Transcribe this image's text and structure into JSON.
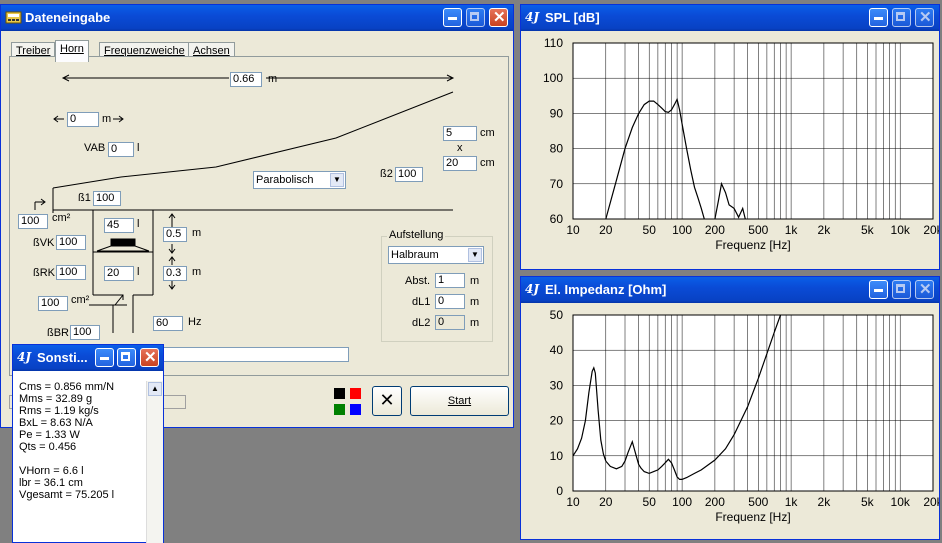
{
  "dateneingabe": {
    "title": "Dateneingabe",
    "tabs": [
      {
        "label": "Treiber"
      },
      {
        "label": "Horn"
      },
      {
        "label": "Frequenzweiche"
      },
      {
        "label": "Achsen"
      }
    ],
    "horn": {
      "length_value": "0.66",
      "length_unit": "m",
      "offset_value": "0",
      "offset_unit": "m",
      "vab_label": "VAB",
      "vab_value": "0",
      "vab_unit": "l",
      "mouth_w_value": "5",
      "mouth_w_unit": "cm",
      "times": "x",
      "mouth_h_value": "20",
      "mouth_h_unit": "cm",
      "profile_selected": "Parabolisch",
      "beta1_label": "ß1",
      "beta1_value": "100",
      "beta2_label": "ß2",
      "beta2_value": "100",
      "throat_value": "100",
      "throat_unit": "cm²",
      "bvk_label": "ßVK",
      "bvk_value": "100",
      "vk_value": "45",
      "vk_unit": "l",
      "rk_value": "20",
      "rk_unit": "l",
      "brk_label": "ßRK",
      "brk_value": "100",
      "d1_value": "0.5",
      "d1_unit": "m",
      "d2_value": "0.3",
      "d2_unit": "m",
      "port_value": "100",
      "port_unit": "cm²",
      "bbr_label": "ßBR",
      "bbr_value": "100",
      "freq_value": "60",
      "freq_unit": "Hz",
      "aufstellung": {
        "label": "Aufstellung",
        "selected": "Halbraum",
        "abst_label": "Abst.",
        "abst_value": "1",
        "abst_unit": "m",
        "dl1_label": "dL1",
        "dl1_value": "0",
        "dl1_unit": "m",
        "dl2_label": "dL2",
        "dl2_value": "0",
        "dl2_unit": "m"
      }
    },
    "start_label": "Start",
    "colors": {
      "black": "#000000",
      "red": "#ff0000",
      "green": "#008000",
      "blue": "#0000ff"
    }
  },
  "sonstiges": {
    "title": "Sonsti...",
    "lines": [
      "Cms = 0.856 mm/N",
      "Mms = 32.89 g",
      "Rms = 1.19 kg/s",
      "BxL = 8.63 N/A",
      "Pe = 1.33 W",
      "Qts = 0.456",
      "",
      "VHorn = 6.6 l",
      "lbr = 36.1 cm",
      "Vgesamt = 75.205 l"
    ]
  },
  "spl_window": {
    "title": "SPL [dB]"
  },
  "impedance_window": {
    "title": "El. Impedanz [Ohm]"
  },
  "chart_data": [
    {
      "type": "line",
      "title": "SPL [dB]",
      "xlabel": "Frequenz [Hz]",
      "ylabel": "",
      "x_scale": "log",
      "xlim": [
        10,
        20000
      ],
      "ylim": [
        60,
        110
      ],
      "x_ticks": [
        "10",
        "20",
        "50",
        "100",
        "200",
        "500",
        "1k",
        "2k",
        "5k",
        "10k",
        "20k"
      ],
      "y_ticks": [
        "60",
        "70",
        "80",
        "90",
        "100",
        "110"
      ],
      "grid": true,
      "series": [
        {
          "color": "#000000",
          "x": [
            20,
            25,
            30,
            35,
            40,
            45,
            50,
            55,
            60,
            65,
            70,
            75,
            80,
            85,
            90,
            95,
            100,
            110,
            120,
            130,
            140,
            150,
            160
          ],
          "y": [
            60,
            71,
            80,
            86,
            90,
            92.5,
            93.5,
            93.5,
            92.5,
            91.5,
            90.5,
            90.3,
            91,
            92.5,
            94,
            91,
            87,
            80,
            74,
            69,
            66,
            63,
            60
          ]
        },
        {
          "color": "#000000",
          "x": [
            200,
            215,
            230,
            250,
            270,
            300,
            330,
            360,
            380
          ],
          "y": [
            60,
            65,
            70,
            67.5,
            64,
            63,
            60.5,
            63,
            60
          ]
        }
      ]
    },
    {
      "type": "line",
      "title": "El. Impedanz [Ohm]",
      "xlabel": "Frequenz [Hz]",
      "ylabel": "",
      "x_scale": "log",
      "xlim": [
        10,
        20000
      ],
      "ylim": [
        0,
        50
      ],
      "x_ticks": [
        "10",
        "20",
        "50",
        "100",
        "200",
        "500",
        "1k",
        "2k",
        "5k",
        "10k",
        "20k"
      ],
      "y_ticks": [
        "0",
        "10",
        "20",
        "30",
        "40",
        "50"
      ],
      "grid": true,
      "series": [
        {
          "color": "#000000",
          "x": [
            10,
            11,
            12,
            13,
            14,
            15,
            15.5,
            16,
            17,
            18,
            19,
            20,
            22,
            25,
            28,
            30,
            32,
            35,
            38,
            40,
            42,
            45,
            50,
            55,
            60,
            65,
            70,
            75,
            80,
            85,
            90,
            95,
            100,
            110,
            130,
            150,
            200,
            250,
            300,
            400,
            500,
            600,
            700,
            800
          ],
          "y": [
            10,
            12,
            15,
            20,
            28,
            34,
            35,
            33.5,
            23,
            14.5,
            10.5,
            8.5,
            7,
            6.3,
            7,
            8.5,
            11,
            14,
            10,
            7.5,
            6.5,
            5.5,
            5,
            5.5,
            6,
            7,
            8,
            9,
            8,
            6,
            4,
            3.3,
            3.3,
            3.8,
            5,
            6,
            8.8,
            12,
            16,
            24,
            32,
            39,
            45,
            50
          ]
        }
      ]
    }
  ]
}
